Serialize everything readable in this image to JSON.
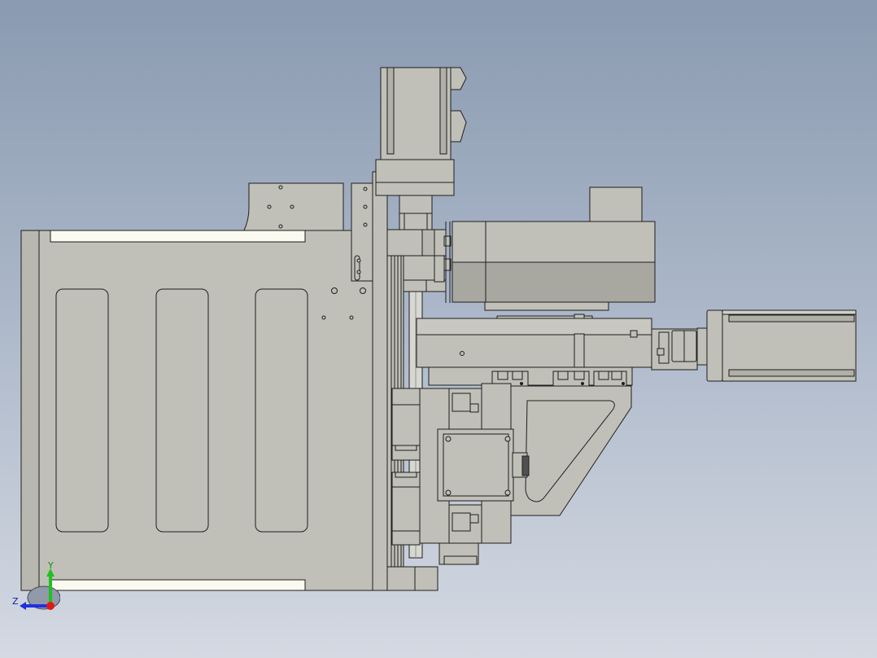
{
  "view": {
    "background_top": "#8a9ab0",
    "background_bottom": "#d4d9e2",
    "part_fill": "#c0c0b8",
    "part_fill_dark": "#a8a8a0",
    "edge_color": "#1e1e1e",
    "slot_fill": "#fafaf0"
  },
  "triad": {
    "y_label": "Y",
    "z_label": "Z",
    "x_axis_color": "#e01818",
    "y_axis_color": "#20c020",
    "z_axis_color": "#2030e0"
  }
}
